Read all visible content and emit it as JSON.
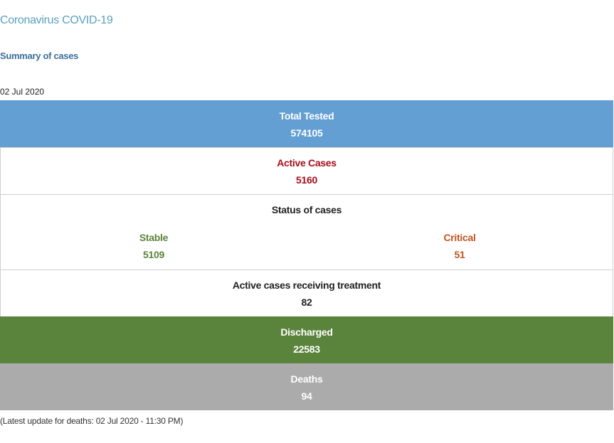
{
  "header": {
    "title": "Coronavirus COVID-19",
    "subtitle": "Summary of cases",
    "date": "02 Jul 2020"
  },
  "stats": {
    "total_tested": {
      "label": "Total Tested",
      "value": "574105"
    },
    "active_cases": {
      "label": "Active Cases",
      "value": "5160"
    },
    "status_of_cases": {
      "label": "Status of cases",
      "stable": {
        "label": "Stable",
        "value": "5109"
      },
      "critical": {
        "label": "Critical",
        "value": "51"
      }
    },
    "treatment": {
      "label": "Active cases receiving treatment",
      "value": "82"
    },
    "discharged": {
      "label": "Discharged",
      "value": "22583"
    },
    "deaths": {
      "label": "Deaths",
      "value": "94"
    }
  },
  "footer": {
    "note": "(Latest update for deaths: 02 Jul 2020 - 11:30 PM)"
  },
  "colors": {
    "total_tested_bg": "#639fd3",
    "active_text": "#a80e1c",
    "stable_text": "#5a833b",
    "critical_text": "#c0541f",
    "discharged_bg": "#5a833b",
    "deaths_bg": "#ababab"
  }
}
